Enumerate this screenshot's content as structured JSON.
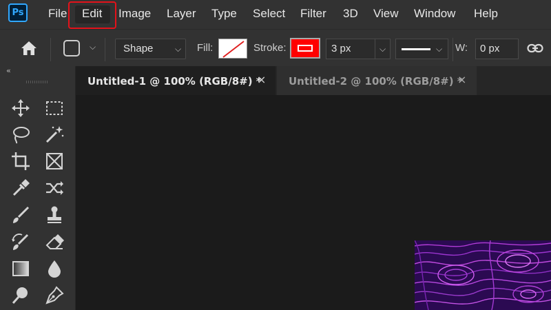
{
  "app": {
    "logo_text": "Ps"
  },
  "menubar": {
    "items": [
      "File",
      "Edit",
      "Image",
      "Layer",
      "Type",
      "Select",
      "Filter",
      "3D",
      "View",
      "Window",
      "Help"
    ],
    "highlighted": "Edit",
    "highlight_color": "#e5121a"
  },
  "options": {
    "shape_mode_value": "Shape",
    "fill_label": "Fill:",
    "stroke_label": "Stroke:",
    "stroke_color": "#ff0000",
    "stroke_width": "3 px",
    "w_label": "W:",
    "w_value": "0 px"
  },
  "tabs": [
    {
      "label": "Untitled-1 @ 100% (RGB/8#) *",
      "active": true
    },
    {
      "label": "Untitled-2 @ 100% (RGB/8#) *",
      "active": false
    }
  ],
  "icons": {
    "home": "home-icon",
    "link": "link-icon",
    "close": "×",
    "chevron": "⌵",
    "collapse": "‹‹"
  },
  "toolbar": {
    "tools": [
      "move-icon",
      "marquee-icon",
      "lasso-icon",
      "magic-wand-icon",
      "crop-icon",
      "frame-icon",
      "eyedropper-icon",
      "content-aware-move-icon",
      "brush-icon",
      "stamp-icon",
      "history-brush-icon",
      "eraser-icon",
      "gradient-icon",
      "blur-drop-icon",
      "dodge-icon",
      "pen-icon"
    ]
  }
}
